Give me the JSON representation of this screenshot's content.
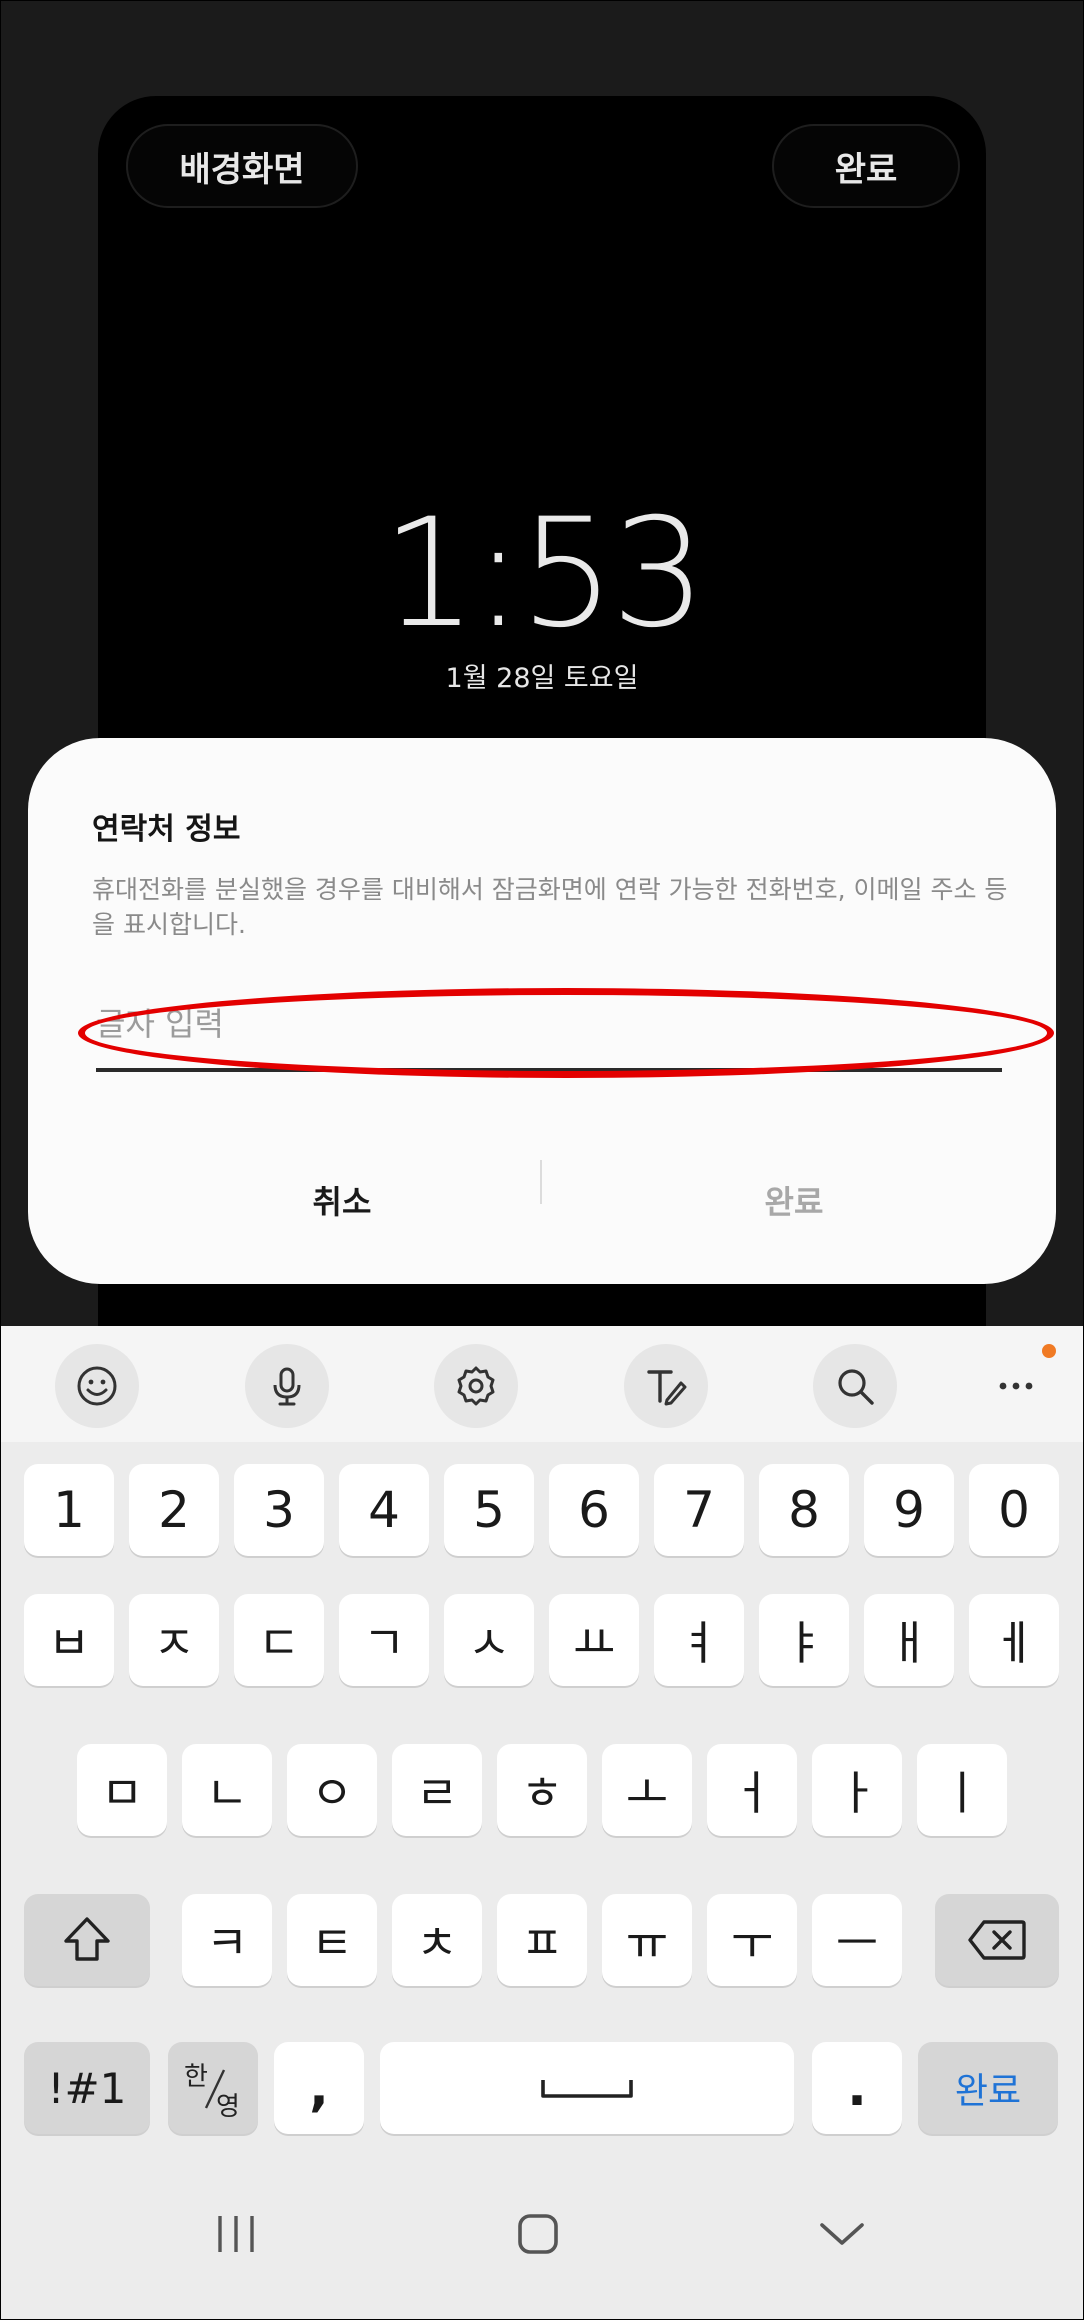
{
  "lockscreen": {
    "wallpaper_label": "배경화면",
    "done_label": "완료",
    "time": "1:53",
    "date": "1월 28일 토요일"
  },
  "dialog": {
    "title": "연락처 정보",
    "description": "휴대전화를 분실했을 경우를 대비해서 잠금화면에 연락 가능한 전화번호, 이메일 주소 등을 표시합니다.",
    "input_placeholder": "글자 입력",
    "input_value": "",
    "cancel_label": "취소",
    "done_label": "완료"
  },
  "highlight_color": "#e30000",
  "keyboard": {
    "toolbar": [
      "emoji-icon",
      "microphone-icon",
      "settings-gear-icon",
      "handwriting-icon",
      "search-icon",
      "more-options-icon"
    ],
    "notification_dot_color": "#f07a24",
    "row_numbers": [
      "1",
      "2",
      "3",
      "4",
      "5",
      "6",
      "7",
      "8",
      "9",
      "0"
    ],
    "row1": [
      "ㅂ",
      "ㅈ",
      "ㄷ",
      "ㄱ",
      "ㅅ",
      "ㅛ",
      "ㅕ",
      "ㅑ",
      "ㅐ",
      "ㅔ"
    ],
    "row2": [
      "ㅁ",
      "ㄴ",
      "ㅇ",
      "ㄹ",
      "ㅎ",
      "ㅗ",
      "ㅓ",
      "ㅏ",
      "ㅣ"
    ],
    "row3": [
      "ㅋ",
      "ㅌ",
      "ㅊ",
      "ㅍ",
      "ㅠ",
      "ㅜ",
      "ㅡ"
    ],
    "symbols_label": "!#1",
    "lang_top": "한",
    "lang_bottom": "영",
    "comma": ",",
    "period": ".",
    "done_label": "완료",
    "done_color": "#1f73d6"
  },
  "navigation": [
    "recent-apps-icon",
    "home-icon",
    "back-icon"
  ]
}
